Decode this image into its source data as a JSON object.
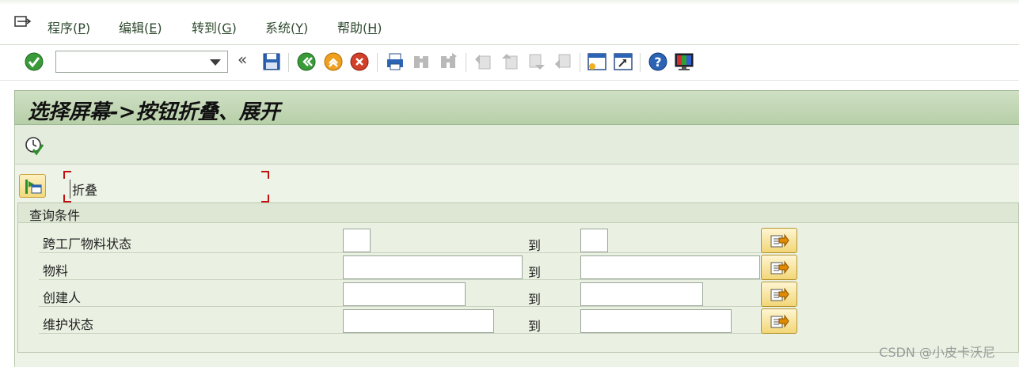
{
  "menubar": {
    "items": [
      {
        "label": "程序(",
        "key": "P",
        "end": ")"
      },
      {
        "label": "编辑(",
        "key": "E",
        "end": ")"
      },
      {
        "label": "转到(",
        "key": "G",
        "end": ")"
      },
      {
        "label": "系统(",
        "key": "Y",
        "end": ")"
      },
      {
        "label": "帮助(",
        "key": "H",
        "end": ")"
      }
    ]
  },
  "toolbar": {
    "command_field_value": "",
    "icons": [
      "enter-check-icon",
      "save-icon",
      "back-icon",
      "exit-icon",
      "cancel-icon",
      "print-icon",
      "find-icon",
      "find-next-icon",
      "first-page-icon",
      "previous-page-icon",
      "next-page-icon",
      "last-page-icon",
      "create-session-icon",
      "shortcut-icon",
      "help-icon",
      "layout-icon"
    ]
  },
  "screen": {
    "title": "选择屏幕->按钮折叠、展开"
  },
  "collapse": {
    "label": "折叠"
  },
  "group": {
    "title": "查询条件",
    "to_label": "到",
    "rows": [
      {
        "label": "跨工厂物料状态",
        "low": "",
        "high": ""
      },
      {
        "label": "物料",
        "low": "",
        "high": ""
      },
      {
        "label": "创建人",
        "low": "",
        "high": ""
      },
      {
        "label": "维护状态",
        "low": "",
        "high": ""
      }
    ]
  },
  "watermark": "CSDN @小皮卡沃尼",
  "colors": {
    "title_bar": "#b7cfa8",
    "content_bg": "#edf3e7",
    "button_yellow": "#f2d676",
    "focus_corner": "#c01010"
  }
}
